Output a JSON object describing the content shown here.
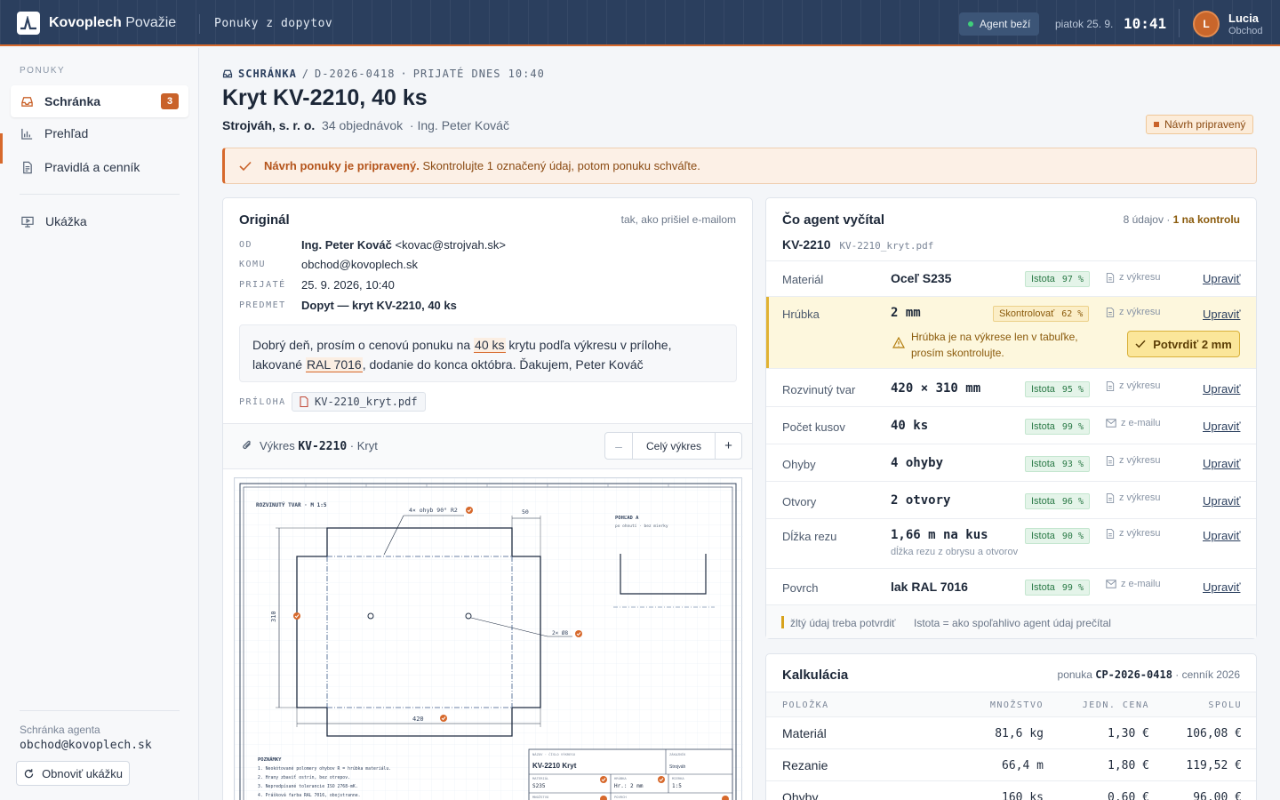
{
  "topbar": {
    "brand": "Kovoplech",
    "brand_region": "Považie",
    "section": "Ponuky z dopytov",
    "agent_status": "Agent beží",
    "date": "piatok 25. 9.",
    "time": "10:41",
    "user_initial": "L",
    "user_name": "Lucia",
    "user_role": "Obchod",
    "accent": "#d7692c",
    "bar_color": "#2b3f5e"
  },
  "sidebar": {
    "heading": "PONUKY",
    "items": [
      {
        "label": "Schránka",
        "icon": "inbox-icon",
        "badge": "3"
      },
      {
        "label": "Prehľad",
        "icon": "bar-chart-icon"
      },
      {
        "label": "Pravidlá a cenník",
        "icon": "document-icon"
      },
      {
        "label": "Ukážka",
        "icon": "monitor-icon"
      }
    ],
    "footer_label": "Schránka agenta",
    "footer_email": "obchod@kovoplech.sk",
    "reset_label": "Obnoviť ukážku"
  },
  "header": {
    "crumb_inbox": "SCHRÁNKA",
    "crumb_sep": "/",
    "crumb_id": "D-2026-0418",
    "crumb_dot": "·",
    "crumb_received": "PRIJATÉ DNES 10:40",
    "title": "Kryt KV-2210, 40 ks",
    "company": "Strojváh, s. r. o.",
    "orders": "34 objednávok",
    "contact": "· Ing. Peter Kováč",
    "status_pill": "Návrh pripravený"
  },
  "alert": {
    "strong": "Návrh ponuky je pripravený.",
    "text": "Skontrolujte 1 označený údaj, potom ponuku schváľte."
  },
  "original": {
    "title": "Originál",
    "note": "tak, ako prišiel e-mailom",
    "from_label": "OD",
    "from_name": "Ing. Peter Kováč",
    "from_email": "<kovac@strojvah.sk>",
    "to_label": "KOMU",
    "to": "obchod@kovoplech.sk",
    "received_label": "PRIJATÉ",
    "received": "25. 9. 2026, 10:40",
    "subject_label": "PREDMET",
    "subject": "Dopyt — kryt KV-2210, 40 ks",
    "body_1": "Dobrý deň, prosím o cenovú ponuku na ",
    "body_qty": "40 ks",
    "body_2": " krytu podľa výkresu v prílohe, lakované",
    "body_color": "RAL 7016",
    "body_3": ", dodanie do konca októbra. Ďakujem, Peter Kováč",
    "attachment_label": "PRÍLOHA",
    "attachment": "KV-2210_kryt.pdf"
  },
  "drawing": {
    "prefix": "Výkres",
    "code": "KV-2210",
    "suffix": "· Kryt",
    "zoom_minus": "–",
    "zoom_label": "Celý výkres",
    "zoom_plus": "+",
    "view_title": "ROZVINUTÝ TVAR · M 1:5",
    "bend_note": "4× ohyb 90° R2",
    "dim_flange": "50",
    "dim_height": "310",
    "dim_width": "420",
    "holes_note": "2× Ø8",
    "side_view_title": "POHĽAD A",
    "side_view_sub": "po ohnutí · bez mierky",
    "notes_title": "POZNÁMKY",
    "notes": [
      "1. Neokótované polomery ohybov R = hrúbka materiálu.",
      "2. Hrany zbaviť ostrín, bez otrepov.",
      "3. Nepredpísané tolerancie ISO 2768-mK.",
      "4. Prášková farba RAL 7016, obojstranne."
    ],
    "tb_name_label": "NÁZOV · ČÍSLO VÝKRESU",
    "tb_name": "KV-2210 Kryt",
    "tb_customer_label": "ZÁKAZNÍK",
    "tb_customer": "Strojváh",
    "tb_material_label": "MATERIÁL",
    "tb_material": "S235",
    "tb_thickness_label": "HRÚBKA",
    "tb_thickness": "Hr.: 2 mm",
    "tb_scale_label": "MIERKA",
    "tb_scale": "1:5",
    "tb_qty_label": "MNOŽSTVO",
    "tb_surface_label": "POVRCH"
  },
  "extracted": {
    "title": "Čo agent vyčítal",
    "summary_count": "8 údajov ·",
    "summary_flag": "1 na kontrolu",
    "part": "KV-2210",
    "file": "KV-2210_kryt.pdf",
    "fields": [
      {
        "name": "Materiál",
        "value": "Oceľ S235",
        "conf_label": "Istota",
        "conf": "97 %",
        "source": "z výkresu",
        "source_icon": "document-icon",
        "edit": "Upraviť"
      },
      {
        "name": "Hrúbka",
        "value": "2 mm",
        "conf_label": "Skontrolovať",
        "conf": "62 %",
        "source": "z výkresu",
        "source_icon": "document-icon",
        "edit": "Upraviť",
        "warning": "Hrúbka je na výkrese len v tabuľke, prosím skontrolujte.",
        "confirm": "Potvrdiť 2 mm"
      },
      {
        "name": "Rozvinutý tvar",
        "value": "420 × 310 mm",
        "conf_label": "Istota",
        "conf": "95 %",
        "source": "z výkresu",
        "source_icon": "document-icon",
        "edit": "Upraviť"
      },
      {
        "name": "Počet kusov",
        "value": "40 ks",
        "conf_label": "Istota",
        "conf": "99 %",
        "source": "z e-mailu",
        "source_icon": "mail-icon",
        "edit": "Upraviť"
      },
      {
        "name": "Ohyby",
        "value": "4 ohyby",
        "conf_label": "Istota",
        "conf": "93 %",
        "source": "z výkresu",
        "source_icon": "document-icon",
        "edit": "Upraviť"
      },
      {
        "name": "Otvory",
        "value": "2 otvory",
        "conf_label": "Istota",
        "conf": "96 %",
        "source": "z výkresu",
        "source_icon": "document-icon",
        "edit": "Upraviť"
      },
      {
        "name": "Dĺžka rezu",
        "value": "1,66 m na kus",
        "sub": "dĺžka rezu z obrysu a otvorov",
        "conf_label": "Istota",
        "conf": "90 %",
        "source": "z výkresu",
        "source_icon": "document-icon",
        "edit": "Upraviť"
      },
      {
        "name": "Povrch",
        "value": "lak RAL 7016",
        "conf_label": "Istota",
        "conf": "99 %",
        "source": "z e-mailu",
        "source_icon": "mail-icon",
        "edit": "Upraviť"
      }
    ],
    "legend_yellow": "žltý údaj treba potvrdiť",
    "legend_conf": "Istota = ako spoľahlivo agent údaj prečítal"
  },
  "calc": {
    "title": "Kalkulácia",
    "offer_prefix": "ponuka",
    "offer_id": "CP-2026-0418",
    "pricelist": "· cenník 2026",
    "col_item": "POLOŽKA",
    "col_qty": "MNOŽSTVO",
    "col_unit": "JEDN. CENA",
    "col_total": "SPOLU",
    "rows": [
      {
        "item": "Materiál",
        "qty": "81,6 kg",
        "unit": "1,30 €",
        "total": "106,08 €"
      },
      {
        "item": "Rezanie",
        "qty": "66,4 m",
        "unit": "1,80 €",
        "total": "119,52 €"
      },
      {
        "item": "Ohyby",
        "qty": "160 ks",
        "unit": "0,60 €",
        "total": "96,00 €"
      }
    ]
  }
}
